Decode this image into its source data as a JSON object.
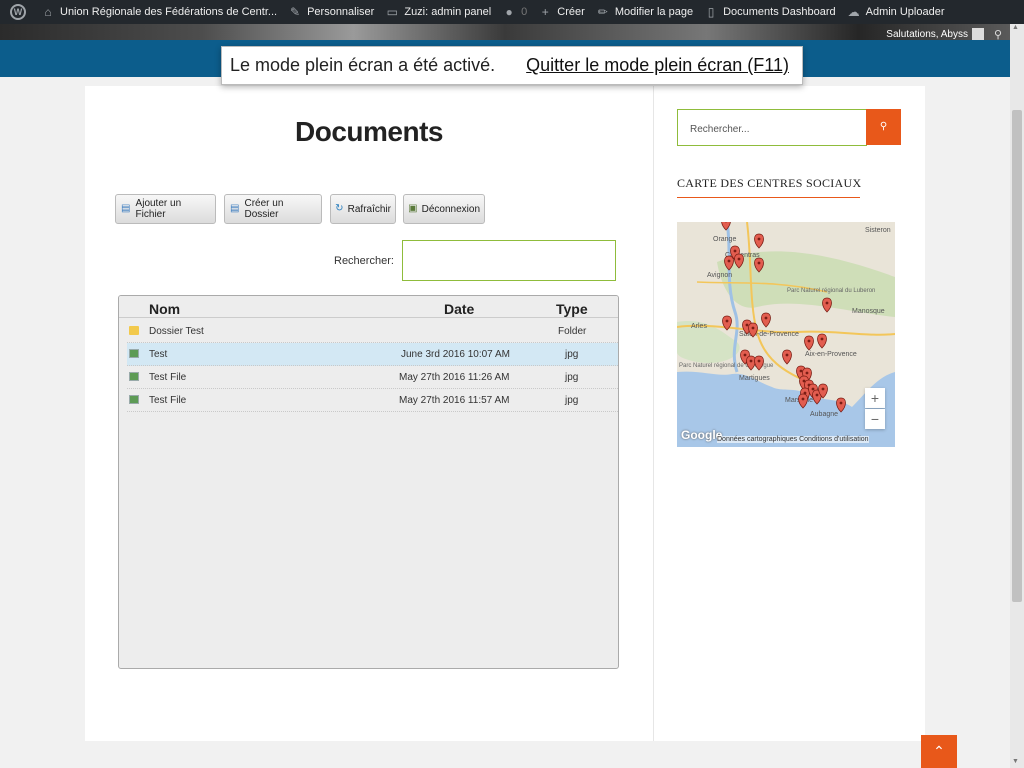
{
  "admin_bar": {
    "site_name": "Union Régionale des Fédérations de Centr...",
    "customize": "Personnaliser",
    "admin_panel": "Zuzi: admin panel",
    "comments_count": "0",
    "new": "Créer",
    "edit_page": "Modifier la page",
    "documents_dashboard": "Documents Dashboard",
    "admin_uploader": "Admin Uploader"
  },
  "header": {
    "greeting": "Salutations, Abyss"
  },
  "fullscreen_notice": {
    "message": "Le mode plein écran a été activé.",
    "exit_link": "Quitter le mode plein écran (F11)"
  },
  "main": {
    "title": "Documents",
    "toolbar": {
      "add_file": "Ajouter un Fichier",
      "create_folder": "Créer un Dossier",
      "refresh": "Rafraîchir",
      "logout": "Déconnexion"
    },
    "search_label": "Rechercher:",
    "grid": {
      "columns": [
        "Nom",
        "Date",
        "Type"
      ],
      "rows": [
        {
          "name": "Dossier Test",
          "date": "",
          "type": "Folder",
          "kind": "folder",
          "selected": false
        },
        {
          "name": "Test",
          "date": "June 3rd 2016 10:07 AM",
          "type": "jpg",
          "kind": "image",
          "selected": true
        },
        {
          "name": "Test File",
          "date": "May 27th 2016 11:26 AM",
          "type": "jpg",
          "kind": "image",
          "selected": false
        },
        {
          "name": "Test File",
          "date": "May 27th 2016 11:57 AM",
          "type": "jpg",
          "kind": "image",
          "selected": false
        }
      ]
    }
  },
  "sidebar": {
    "search_placeholder": "Rechercher...",
    "widget_title": "CARTE DES CENTRES SOCIAUX",
    "map": {
      "place_labels": [
        "Orange",
        "Carpentras",
        "Avignon",
        "Sisteron",
        "Arles",
        "Manosque",
        "Parc Naturel régional du Luberon",
        "Salon-de-Provence",
        "Aix-en-Provence",
        "Martigues",
        "Marseille",
        "Aubagne",
        "Parc Naturel régional de Camargue"
      ],
      "zoom_in": "+",
      "zoom_out": "−",
      "google": "Google",
      "attribution": "Données cartographiques   Conditions d'utilisation"
    }
  },
  "icons": {
    "wordpress": "wordpress-logo-icon",
    "home": "home-icon",
    "paintbrush": "paintbrush-icon",
    "comment": "comment-icon",
    "plus": "plus-icon",
    "pencil": "pencil-icon",
    "document": "document-icon",
    "cloud": "cloud-icon",
    "search": "search-icon",
    "arrow_up": "arrow-up-icon"
  },
  "colors": {
    "admin_bar_bg": "#23282d",
    "header_blue": "#0c5d8c",
    "accent_orange": "#e8581a",
    "input_border_green": "#8fbc3b",
    "selected_row": "#d3e8f4",
    "map_water": "#a8c7e8",
    "map_marker": "#e25d4f"
  }
}
